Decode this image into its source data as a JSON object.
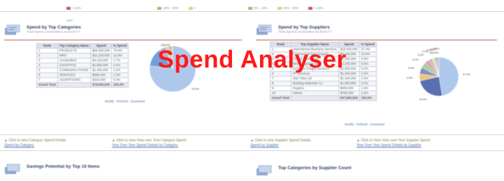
{
  "overlay": {
    "title": "Spend Analyser"
  },
  "left_panel": {
    "title": "Spend by Top Categories",
    "subtitle": "Total Spend unclassified as BCB FY",
    "chart_title": "Spend",
    "table": {
      "headers": [
        "Rank",
        "Top Category Name",
        "Spend",
        "% Spend"
      ],
      "rows": [
        [
          "1",
          "PRODUCTS",
          "$66,000,000",
          "75.9%"
        ],
        [
          "2",
          "MRO",
          "$11,220,000",
          "12.9%"
        ],
        [
          "3",
          "Unclassified",
          "$4,120,000",
          "4.7%"
        ],
        [
          "4",
          "LOGISTICS",
          "$1,800,000",
          "2.0%"
        ],
        [
          "5",
          "COMMUNICATIONS",
          "$1,400,000",
          "1.6%"
        ],
        [
          "6",
          "SERVICES",
          "$890,000",
          "1.0%"
        ],
        [
          "7",
          "ADVERTISING",
          "$320,000",
          "0.3%"
        ]
      ],
      "total": [
        "Grand Total",
        "",
        "$75,600,000",
        "100.0%"
      ]
    },
    "pie_values": [
      75.9,
      12.9,
      4.7,
      2.0,
      1.6,
      1.0,
      0.3
    ],
    "pie_colors": [
      "#aec8ec",
      "#6fa0e0",
      "#b0b0d8",
      "#e8d090",
      "#9ad09a",
      "#e09a9a",
      "#c8c8c8"
    ],
    "pie_label": "75.9%",
    "links": "Modify - Refresh - Download"
  },
  "right_panel": {
    "title": "Spend by Top Suppliers",
    "subtitle": "Total Spend unclassified as BCB FY",
    "chart_title": "Spend",
    "table": {
      "headers": [
        "Rank",
        "Top Supplier Name",
        "Spend",
        "% Spend"
      ],
      "rows": [
        [
          "1",
          "International Business Services",
          "$18,000,000",
          "47.4%"
        ],
        [
          "2",
          "Commercial Steel Supply",
          "$9,100,000",
          "24.0%"
        ],
        [
          "3",
          "Global Distribution",
          "$2,200,000",
          "5.8%"
        ],
        [
          "4",
          "Metro Logistics Inc",
          "$2,100,000",
          "5.5%"
        ],
        [
          "5",
          "Southern Freight Services",
          "$1,900,000",
          "5.0%"
        ],
        [
          "6",
          "PT Services",
          "$1,300,000",
          "3.4%"
        ],
        [
          "7",
          "Star Tube Ltd",
          "$1,100,000",
          "2.9%"
        ],
        [
          "8",
          "Building Materials Co",
          "$1,000,000",
          "2.6%"
        ],
        [
          "9",
          "Hegelco",
          "$600,000",
          "1.6%"
        ],
        [
          "10",
          "Others",
          "$700,000",
          "1.8%"
        ]
      ],
      "total": [
        "Grand Total",
        "",
        "$37,800,000",
        "100.0%"
      ]
    },
    "pie_values": [
      47.4,
      24.0,
      5.8,
      5.5,
      5.0,
      3.4,
      2.9,
      2.6,
      1.6,
      1.8
    ],
    "pie_colors": [
      "#aec8ec",
      "#5a6fb0",
      "#e8c880",
      "#8c8cc8",
      "#a8d0a0",
      "#e0a0a0",
      "#c0c0c0",
      "#f0e0a0",
      "#90b8d8",
      "#d0b0e0"
    ],
    "pie_labels": [
      "47.4%",
      "24.0%",
      "5.8%",
      "5.5%",
      "5.0%",
      "3.4%",
      "2.9%",
      "2.6%",
      "1.6%",
      "1.8%"
    ],
    "links": "Modify - Refresh - Download"
  },
  "bottom_links": [
    {
      "text": "Click to view Category Spend Details",
      "sub": "Spend by Category"
    },
    {
      "text": "Click to view View over Year Category Spend",
      "sub": "Year Over Year Spend Details by Category"
    },
    {
      "text": "Click to view Supplier Spend Details",
      "sub": "Spend by Supplier"
    },
    {
      "text": "Click to View View over Year Supplier Spend",
      "sub": "Year Over Year Spend Details by Supplier"
    }
  ],
  "bottom_sections": [
    {
      "title": "Savings Potential by Top 10 Items"
    },
    {
      "title": "Top Categories by Supplier Count"
    }
  ],
  "top_legend_left": [
    "< 10%",
    "10% - 20%",
    "> 20%"
  ],
  "top_legend_right": [
    "0% - 10%",
    "10% - 20%",
    "> 20%"
  ]
}
